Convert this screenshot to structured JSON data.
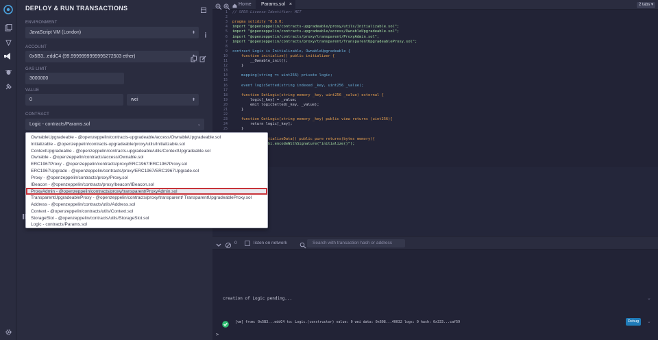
{
  "panel": {
    "title": "DEPLOY & RUN TRANSACTIONS",
    "environment_label": "ENVIRONMENT",
    "environment_value": "JavaScript VM (London)",
    "account_label": "ACCOUNT",
    "account_value": "0x5B3...eddC4 (99.9999999999995272503 ether)",
    "gas_limit_label": "GAS LIMIT",
    "gas_limit_value": "3000000",
    "value_label": "VALUE",
    "value_amount": "0",
    "value_unit": "wei",
    "contract_label": "CONTRACT",
    "contract_value": "Logic - contracts/Params.sol"
  },
  "dropdown": {
    "selected_index": 8,
    "items": [
      "OwnableUpgradeable - @openzeppelin/contracts-upgradeable/access/OwnableUpgradeable.sol",
      "Initializable - @openzeppelin/contracts-upgradeable/proxy/utils/Initializable.sol",
      "ContextUpgradeable - @openzeppelin/contracts-upgradeable/utils/ContextUpgradeable.sol",
      "Ownable - @openzeppelin/contracts/access/Ownable.sol",
      "ERC1967Proxy - @openzeppelin/contracts/proxy/ERC1967/ERC1967Proxy.sol",
      "ERC1967Upgrade - @openzeppelin/contracts/proxy/ERC1967/ERC1967Upgrade.sol",
      "Proxy - @openzeppelin/contracts/proxy/Proxy.sol",
      "IBeacon - @openzeppelin/contracts/proxy/beacon/IBeacon.sol",
      "ProxyAdmin - @openzeppelin/contracts/proxy/transparent/ProxyAdmin.sol",
      "TransparentUpgradeableProxy - @openzeppelin/contracts/proxy/transparent/ TransparentUpgradeableProxy.sol",
      "Address - @openzeppelin/contracts/utils/Address.sol",
      "Context - @openzeppelin/contracts/utils/Context.sol",
      "StorageSlot - @openzeppelin/contracts/utils/StorageSlot.sol",
      "Logic - contracts/Params.sol"
    ]
  },
  "tabs": {
    "home": "Home",
    "file": "Params.sol",
    "count": "2 tabs"
  },
  "editor": {
    "line_numbers": [
      "1",
      "2",
      "3",
      "4",
      "5",
      "6",
      "7",
      "8",
      "9",
      "10",
      "11",
      "12",
      "13",
      "14",
      "15",
      "16",
      "17",
      "18",
      "19",
      "20",
      "21",
      "22",
      "23",
      "24",
      "25",
      "26",
      "27",
      "28",
      "29",
      "30",
      "31"
    ],
    "lines": [
      {
        "t": "// SPDX-License-Identifier: MIT",
        "k": "com"
      },
      {
        "t": "",
        "k": "fn"
      },
      {
        "t": "pragma solidity ^0.8.0;",
        "k": "kw"
      },
      {
        "t": "import \"@openzeppelin/contracts-upgradeable/proxy/utils/Initializable.sol\";",
        "k": "str"
      },
      {
        "t": "import \"@openzeppelin/contracts-upgradeable/access/OwnableUpgradeable.sol\";",
        "k": "str"
      },
      {
        "t": "import \"@openzeppelin/contracts/proxy/transparent/ProxyAdmin.sol\";",
        "k": "str"
      },
      {
        "t": "import \"@openzeppelin/contracts/proxy/transparent/TransparentUpgradeableProxy.sol\";",
        "k": "str"
      },
      {
        "t": "",
        "k": "fn"
      },
      {
        "t": "contract Logic is Initializable, OwnableUpgradeable {",
        "k": "typ"
      },
      {
        "t": "    function initialize() public initializer {",
        "k": "kw"
      },
      {
        "t": "        __Ownable_init();",
        "k": "fn"
      },
      {
        "t": "    }",
        "k": "fn"
      },
      {
        "t": "",
        "k": "fn"
      },
      {
        "t": "    mapping(string => uint256) private logic;",
        "k": "typ"
      },
      {
        "t": "",
        "k": "fn"
      },
      {
        "t": "    event logicSetted(string indexed _key, uint256 _value);",
        "k": "typ"
      },
      {
        "t": "",
        "k": "fn"
      },
      {
        "t": "    function SetLogic(string memory _key, uint256 _value) external {",
        "k": "kw"
      },
      {
        "t": "        logic[_key] = _value;",
        "k": "fn"
      },
      {
        "t": "        emit logicSetted(_key, _value);",
        "k": "fn"
      },
      {
        "t": "    }",
        "k": "fn"
      },
      {
        "t": "",
        "k": "fn"
      },
      {
        "t": "    function GetLogic(string memory _key) public view returns (uint256){",
        "k": "kw"
      },
      {
        "t": "        return logic[_key];",
        "k": "fn"
      },
      {
        "t": "    }",
        "k": "fn"
      },
      {
        "t": "",
        "k": "fn"
      },
      {
        "t": "    function InitializeData() public pure returns(bytes memory){",
        "k": "kw"
      },
      {
        "t": "        return abi.encodeWithSignature(\"initialize()\");",
        "k": "str"
      },
      {
        "t": "    }",
        "k": "fn"
      },
      {
        "t": "}",
        "k": "fn"
      },
      {
        "t": "",
        "k": "fn"
      }
    ]
  },
  "terminal": {
    "counter": "0",
    "listen_label": "listen on network",
    "search_placeholder": "Search with transaction hash or address",
    "pending_text": "creation of Logic pending...",
    "tx_text": "[vm]  from: 0x5B3...eddC4 to: Logic.(constructor) value: 0 wei data: 0x608...40032 logs: 0 hash: 0x333...caf59",
    "debug_label": "Debug",
    "prompt": ">"
  },
  "colors": {
    "selection_border": "#c8343a",
    "debug_button": "#1f7bb8",
    "success_check": "#2fbf71"
  }
}
